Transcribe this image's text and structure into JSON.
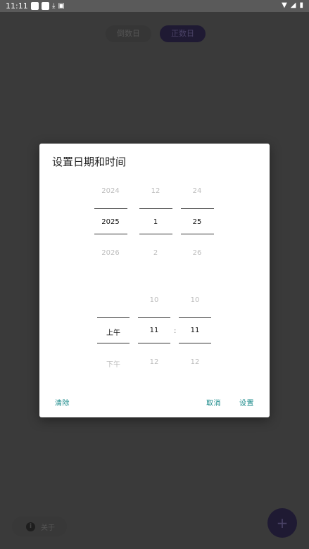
{
  "status_bar": {
    "time": "11:11",
    "left_icons": [
      "notification-square-icon",
      "notification-square-icon",
      "download-icon",
      "box-icon"
    ],
    "right_icons": [
      "wifi-icon",
      "signal-icon",
      "battery-icon"
    ]
  },
  "background": {
    "tabs": [
      {
        "label": "倒数日",
        "active": false
      },
      {
        "label": "正数日",
        "active": true
      }
    ],
    "about_label": "关于",
    "fab_symbol": "+"
  },
  "dialog": {
    "title": "设置日期和时间",
    "date_picker": {
      "year": {
        "prev": "2024",
        "current": "2025",
        "next": "2026"
      },
      "month": {
        "prev": "12",
        "current": "1",
        "next": "2"
      },
      "day": {
        "prev": "24",
        "current": "25",
        "next": "26"
      }
    },
    "time_picker": {
      "ampm": {
        "prev": "",
        "current": "上午",
        "next": "下午"
      },
      "hour": {
        "prev": "10",
        "current": "11",
        "next": "12"
      },
      "minute": {
        "prev": "10",
        "current": "11",
        "next": "12"
      },
      "separator": ":"
    },
    "buttons": {
      "clear": "清除",
      "cancel": "取消",
      "set": "设置"
    }
  },
  "colors": {
    "accent": "#1a8a8a",
    "scrim": "#3a3a3a",
    "dialog_bg": "#ffffff"
  }
}
